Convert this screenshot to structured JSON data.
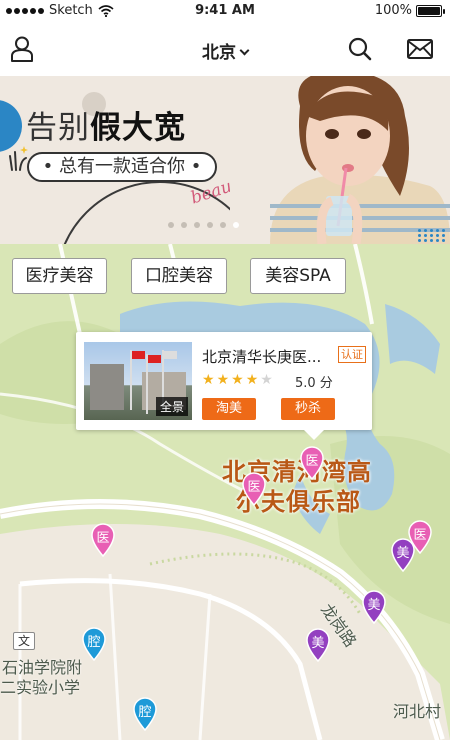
{
  "status_bar": {
    "carrier": "Sketch",
    "time": "9:41 AM",
    "battery": "100%",
    "battery_level": 1.0
  },
  "nav": {
    "city": "北京",
    "user_icon": "user-icon",
    "search_icon": "search-icon",
    "mail_icon": "mail-icon"
  },
  "banner": {
    "headline_prefix": "告别",
    "headline_bold": "假大宽",
    "script_text": "beauty",
    "subline": "• 总有一款适合你 •",
    "slide_count": 6,
    "active_slide": 5
  },
  "categories": [
    {
      "label": "医疗美容"
    },
    {
      "label": "口腔美容"
    },
    {
      "label": "美容SPA"
    }
  ],
  "popup": {
    "title": "北京清华长庚医...",
    "cert": "认证",
    "photo_label": "全景",
    "rating": 4,
    "rating_max": 5,
    "score_text": "5.0 分",
    "tags": [
      {
        "label": "淘美",
        "color": "#ee6a17"
      },
      {
        "label": "秒杀",
        "color": "#ee6a17"
      }
    ]
  },
  "map": {
    "poi_label_line1": "北京清河湾高",
    "poi_label_line2": "尔夫俱乐部",
    "road_label": "龙岗路",
    "school_line1": "石油学院附",
    "school_line2": "二实验小学",
    "village_label": "河北村",
    "school_icon_text": "文",
    "pins": [
      {
        "text": "医",
        "color": "#e85fb4"
      },
      {
        "text": "医",
        "color": "#e85fb4"
      },
      {
        "text": "医",
        "color": "#e85fb4"
      },
      {
        "text": "医",
        "color": "#e85fb4"
      },
      {
        "text": "美",
        "color": "#9340c0"
      },
      {
        "text": "美",
        "color": "#9340c0"
      },
      {
        "text": "美",
        "color": "#9340c0"
      },
      {
        "text": "腔",
        "color": "#1e9ad8"
      },
      {
        "text": "腔",
        "color": "#1e9ad8"
      }
    ]
  },
  "colors": {
    "accent_orange": "#ee6a17",
    "banner_blue": "#2b86c5",
    "map_green": "#d9e6b6",
    "water": "#a9cbe0",
    "poi_text": "#b95816"
  }
}
